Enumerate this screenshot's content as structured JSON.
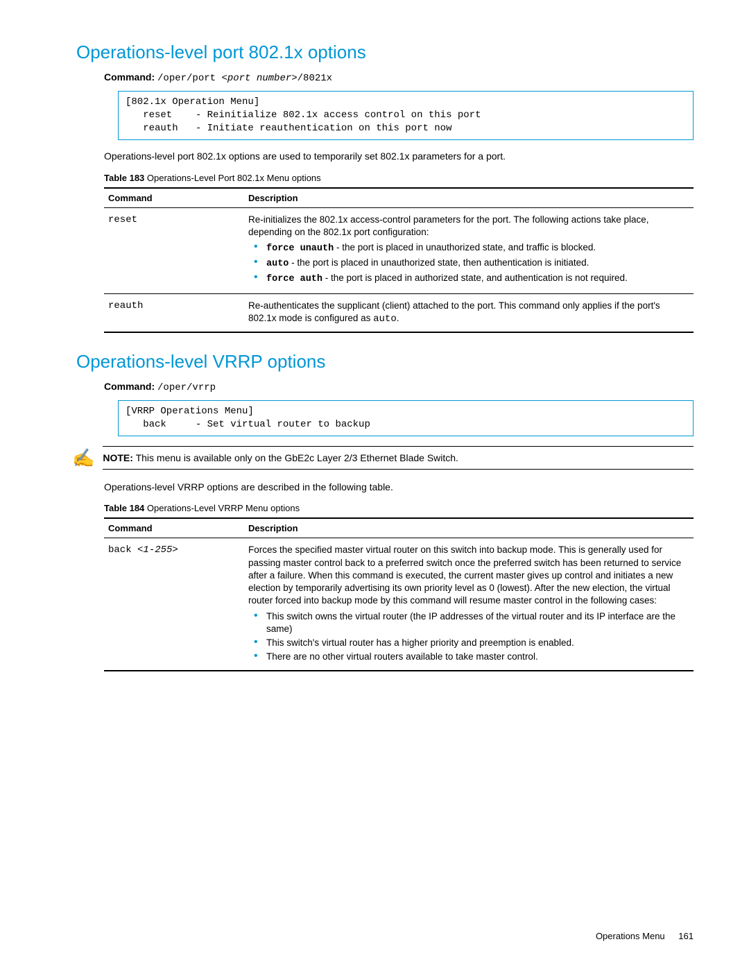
{
  "section1": {
    "heading": "Operations-level port 802.1x options",
    "cmd_label": "Command:",
    "cmd_prefix": "/oper/port ",
    "cmd_param": "<port number>",
    "cmd_suffix": "/8021x",
    "code_box": "[802.1x Operation Menu]\n   reset    - Reinitialize 802.1x access control on this port\n   reauth   - Initiate reauthentication on this port now",
    "intro": "Operations-level port 802.1x options are used to temporarily set 802.1x parameters for a port.",
    "table_caption_label": "Table 183",
    "table_caption": " Operations-Level Port 802.1x Menu options",
    "th_cmd": "Command",
    "th_desc": "Description",
    "rows": {
      "r1": {
        "cmd": "reset",
        "desc": "Re-initializes the 802.1x access-control parameters for the port. The following actions take place, depending on the 802.1x port configuration:",
        "b1_code": "force unauth",
        "b1_rest": " - the port is placed in unauthorized state, and traffic is blocked.",
        "b2_code": "auto",
        "b2_rest": " - the port is placed in unauthorized state, then authentication is initiated.",
        "b3_code": "force auth",
        "b3_rest": " - the port is placed in authorized state, and authentication is not required."
      },
      "r2": {
        "cmd": "reauth",
        "desc_pre": "Re-authenticates the supplicant (client) attached to the port. This command only applies if the port's 802.1x mode is configured as ",
        "desc_code": "auto",
        "desc_post": "."
      }
    }
  },
  "section2": {
    "heading": "Operations-level VRRP options",
    "cmd_label": "Command:",
    "cmd_text": "/oper/vrrp",
    "code_box": "[VRRP Operations Menu]\n   back     - Set virtual router to backup",
    "note_label": "NOTE:",
    "note_text": " This menu is available only on the GbE2c Layer 2/3 Ethernet Blade Switch.",
    "intro": "Operations-level VRRP options are described in the following table.",
    "table_caption_label": "Table 184",
    "table_caption": " Operations-Level VRRP Menu options",
    "th_cmd": "Command",
    "th_desc": "Description",
    "row": {
      "cmd_text": "back ",
      "cmd_param": "<1-255>",
      "desc": "Forces the specified master virtual router on this switch into backup mode. This is generally used for passing master control back to a preferred switch once the preferred switch has been returned to service after a failure. When this command is executed, the current master gives up control and initiates a new election by temporarily advertising its own priority level as 0 (lowest). After the new election, the virtual router forced into backup mode by this command will resume master control in the following cases:",
      "b1": "This switch owns the virtual router (the IP addresses of the virtual router and its IP interface are the same)",
      "b2": "This switch's virtual router has a higher priority and preemption is enabled.",
      "b3": "There are no other virtual routers available to take master control."
    }
  },
  "footer": {
    "text": "Operations Menu",
    "page": "161"
  }
}
